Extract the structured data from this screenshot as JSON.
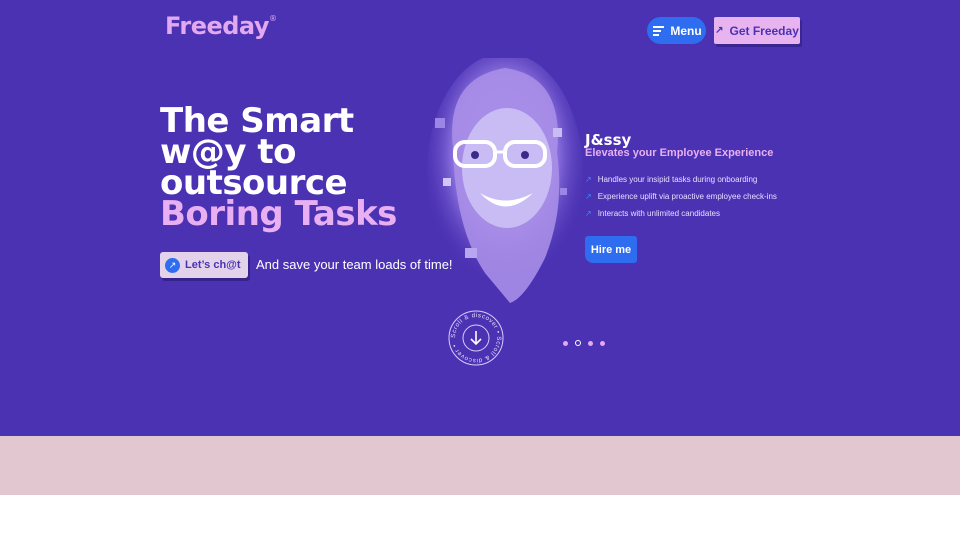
{
  "header": {
    "logo": "Freeday",
    "logo_mark": "®",
    "menu_label": "Menu",
    "cta_label": "Get Freeday"
  },
  "hero": {
    "headline_lines": [
      "The Smart",
      "w@y to",
      "outsource"
    ],
    "headline_accent": "Boring Tasks",
    "chat_label": "Let’s ch@t",
    "tagline": "And save your team loads of time!"
  },
  "persona": {
    "name": "J&ssy",
    "tagline": "Elevates your Employee Experience",
    "features": [
      "Handles your insipid tasks during onboarding",
      "Experience uplift via proactive employee check-ins",
      "Interacts with unlimited candidates"
    ],
    "hire_label": "Hire me"
  },
  "scroll": {
    "label": "Scroll & discover • Scroll & discover •"
  },
  "carousel": {
    "count": 4,
    "active_index": 1
  },
  "colors": {
    "hero_bg": "#4b32b3",
    "accent_pink": "#e8b0f2",
    "accent_blue": "#2f6df0",
    "band": "#e2c7d1"
  }
}
